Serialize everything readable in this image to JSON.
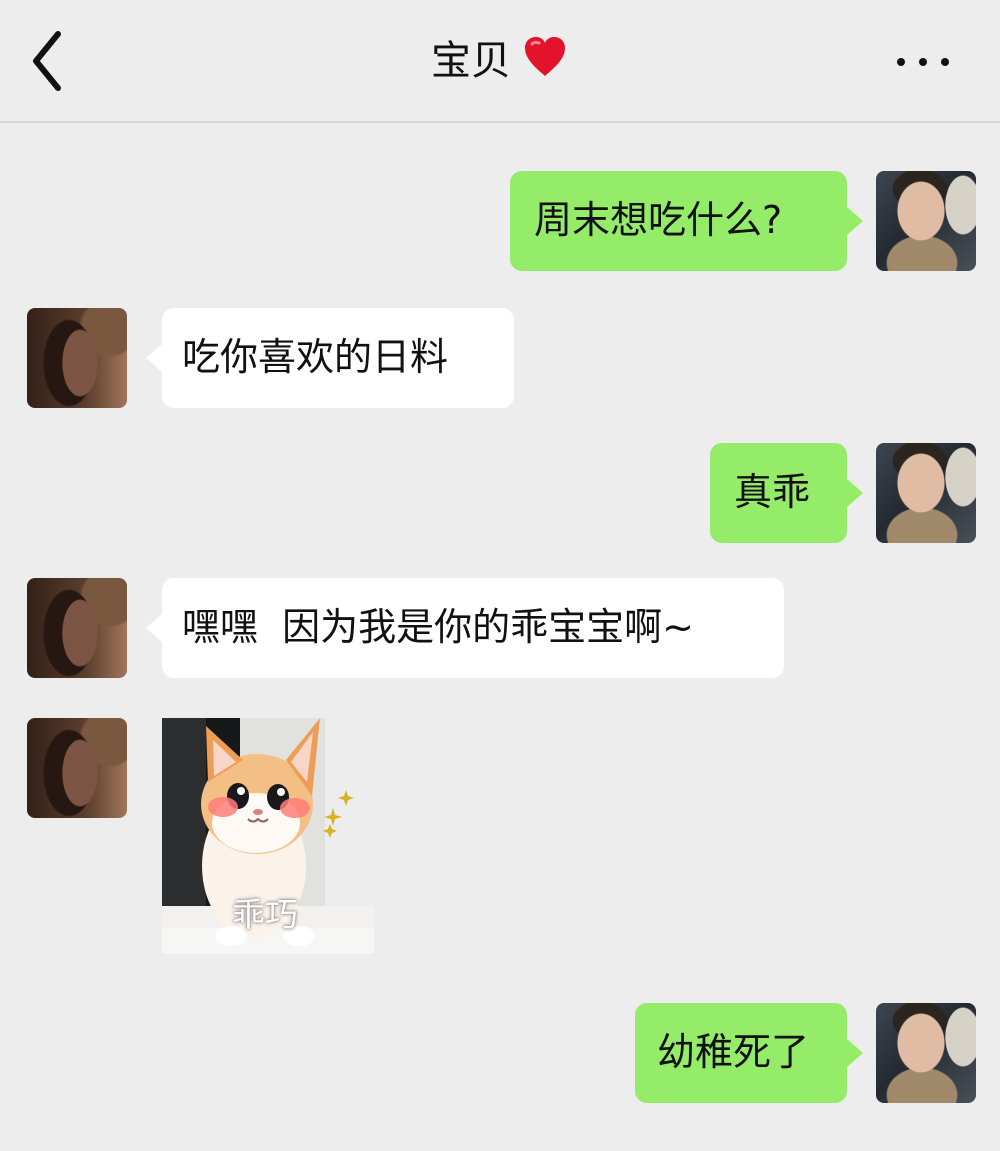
{
  "header": {
    "title": "宝贝",
    "back_icon": "chevron-left-icon",
    "heart_icon": "heart-icon",
    "more_icon": "more-icon"
  },
  "messages": [
    {
      "side": "right",
      "text": "周末想吃什么?"
    },
    {
      "side": "left",
      "text": "吃你喜欢的日料"
    },
    {
      "side": "right",
      "text": "真乖"
    },
    {
      "side": "left",
      "text": "嘿嘿  因为我是你的乖宝宝啊~"
    },
    {
      "side": "left",
      "type": "sticker",
      "caption": "乖巧"
    },
    {
      "side": "right",
      "text": "幼稚死了"
    }
  ],
  "colors": {
    "background": "#ededed",
    "outgoing_bubble": "#95ec69",
    "incoming_bubble": "#ffffff",
    "heart": "#e3132b"
  }
}
